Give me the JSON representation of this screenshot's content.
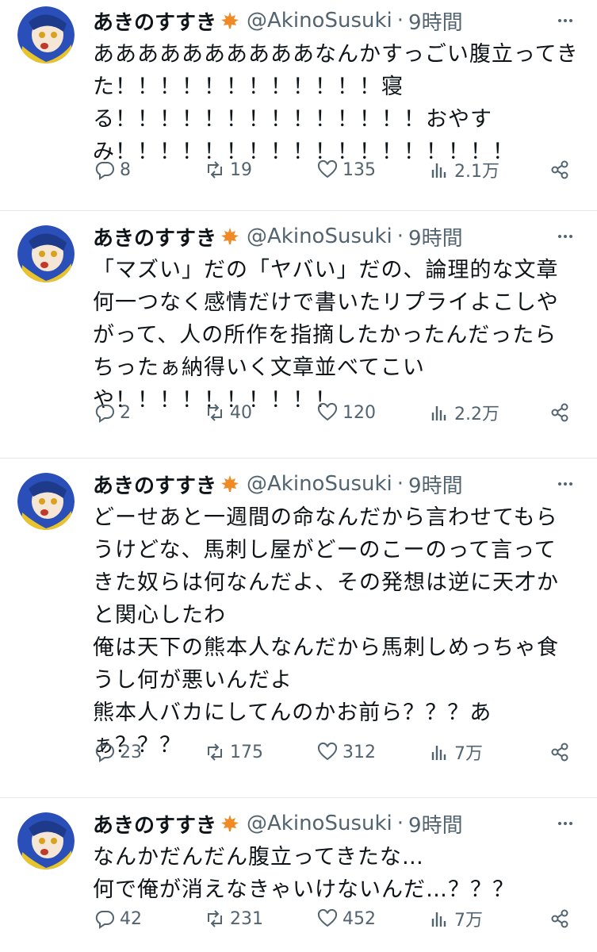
{
  "tweets": [
    {
      "name": "あきのすすき",
      "handle": "@AkinoSusuki",
      "separator": "·",
      "time": "9時間",
      "lines": [
        "ああああああああああなんかすっごい腹立ってき",
        "た！！！！！！！！！！！！寝",
        "る！！！！！！！！！！！！！！おやす",
        "み！！！！！！！！！！！！！！！！！！"
      ],
      "replies": "8",
      "retweets": "19",
      "likes": "135",
      "views": "2.1万"
    },
    {
      "name": "あきのすすき",
      "handle": "@AkinoSusuki",
      "separator": "·",
      "time": "9時間",
      "lines": [
        "「マズい」だの「ヤバい」だの、論理的な文章",
        "何一つなく感情だけで書いたリプライよこしや",
        "がって、人の所作を指摘したかったんだったら",
        "ちったぁ納得いく文章並べてこい",
        "や！！！！！！！！！！"
      ],
      "replies": "2",
      "retweets": "40",
      "likes": "120",
      "views": "2.2万"
    },
    {
      "name": "あきのすすき",
      "handle": "@AkinoSusuki",
      "separator": "·",
      "time": "9時間",
      "lines": [
        "どーせあと一週間の命なんだから言わせてもら",
        "うけどな、馬刺し屋がどーのこーのって言って",
        "きた奴らは何なんだよ、その発想は逆に天才か",
        "と関心したわ",
        "俺は天下の熊本人なんだから馬刺しめっちゃ食",
        "うし何が悪いんだよ",
        "熊本人バカにしてんのかお前ら？？？あ",
        "ぁ？？？"
      ],
      "replies": "23",
      "retweets": "175",
      "likes": "312",
      "views": "7万"
    },
    {
      "name": "あきのすすき",
      "handle": "@AkinoSusuki",
      "separator": "·",
      "time": "9時間",
      "lines": [
        "なんかだんだん腹立ってきたな…",
        "何で俺が消えなきゃいけないんだ…？？？"
      ],
      "replies": "42",
      "retweets": "231",
      "likes": "452",
      "views": "7万"
    }
  ],
  "icons": {
    "leaf": "maple-leaf-icon",
    "more": "more-options-icon",
    "reply": "reply-icon",
    "retweet": "retweet-icon",
    "like": "heart-icon",
    "views": "views-icon",
    "share": "share-icon"
  },
  "colors": {
    "text": "#0f1419",
    "secondary": "#536471",
    "divider": "#e6e9ec",
    "leaf": "#f08a24"
  }
}
